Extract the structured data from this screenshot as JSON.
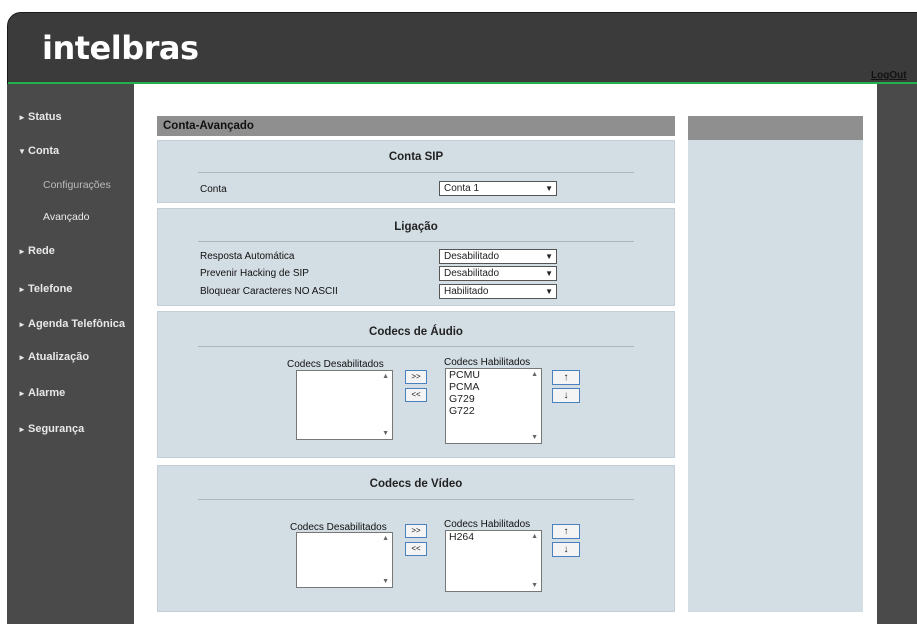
{
  "header": {
    "logo": "intelbras",
    "logout": "LogOut"
  },
  "sidebar": {
    "items": [
      {
        "label": "Status",
        "caret": "►"
      },
      {
        "label": "Conta",
        "caret": "▼"
      },
      {
        "label": "Configurações"
      },
      {
        "label": "Avançado"
      },
      {
        "label": "Rede",
        "caret": "►"
      },
      {
        "label": "Telefone",
        "caret": "►"
      },
      {
        "label": "Agenda Telefônica",
        "caret": "►"
      },
      {
        "label": "Atualização",
        "caret": "►"
      },
      {
        "label": "Alarme",
        "caret": "►"
      },
      {
        "label": "Segurança",
        "caret": "►"
      }
    ]
  },
  "main": {
    "title": "Conta-Avançado",
    "conta_sip": {
      "title": "Conta SIP",
      "conta_label": "Conta",
      "conta_value": "Conta 1"
    },
    "ligacao": {
      "title": "Ligação",
      "resposta_label": "Resposta Automática",
      "resposta_value": "Desabilitado",
      "prevenir_label": "Prevenir Hacking de SIP",
      "prevenir_value": "Desabilitado",
      "bloquear_label": "Bloquear Caracteres NO ASCII",
      "bloquear_value": "Habilitado"
    },
    "audio": {
      "title": "Codecs de Áudio",
      "disabled_label": "Codecs Desabilitados",
      "enabled_label": "Codecs Habilitados",
      "enabled": [
        "PCMU",
        "PCMA",
        "G729",
        "G722"
      ]
    },
    "video": {
      "title": "Codecs de Vídeo",
      "disabled_label": "Codecs Desabilitados",
      "enabled_label": "Codecs Habilitados",
      "enabled": [
        "H264"
      ]
    },
    "buttons": {
      "add": ">>",
      "remove": "<<",
      "up": "↑",
      "down": "↓"
    }
  },
  "colors": {
    "header": "#3b3b3b",
    "green_bar": "#22b14c",
    "section_bg": "#d3dde4",
    "sidebar": "#4a4a4a"
  }
}
